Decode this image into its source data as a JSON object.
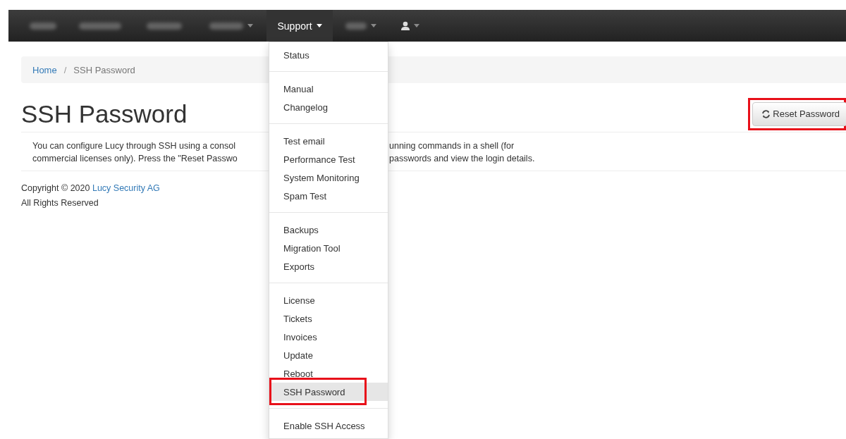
{
  "navbar": {
    "items": [
      {
        "kind": "redacted",
        "selected": false,
        "caret": false
      },
      {
        "kind": "redacted",
        "selected": false,
        "caret": false
      },
      {
        "kind": "redacted",
        "selected": false,
        "caret": false
      },
      {
        "kind": "redacted",
        "selected": false,
        "caret": true
      },
      {
        "kind": "text",
        "label": "Support",
        "selected": true,
        "caret": true
      },
      {
        "kind": "redacted",
        "selected": false,
        "caret": true
      },
      {
        "kind": "user",
        "selected": false,
        "caret": true
      }
    ]
  },
  "breadcrumb": {
    "separator": "/",
    "items": [
      {
        "label": "Home",
        "kind": "link"
      },
      {
        "label": "SSH Password",
        "kind": "current"
      }
    ]
  },
  "heading": "SSH Password",
  "reset_button": {
    "label": "Reset Password",
    "annotated": true
  },
  "paragraph_lines": [
    {
      "left": "You can configure Lucy through SSH using a consol",
      "right": "unning commands in a shell (for"
    },
    {
      "left": "commercial licenses only). Press the \"Reset Passwo",
      "right": "passwords and view the login details."
    }
  ],
  "footer": {
    "copyright": "Copyright © 2020",
    "company": "Lucy Security AG",
    "rights": "All Rights Reserved"
  },
  "support_menu": {
    "groups": [
      [
        {
          "label": "Status",
          "selected": false,
          "annotated": false
        }
      ],
      [
        {
          "label": "Manual",
          "selected": false,
          "annotated": false
        },
        {
          "label": "Changelog",
          "selected": false,
          "annotated": false
        }
      ],
      [
        {
          "label": "Test email",
          "selected": false,
          "annotated": false
        },
        {
          "label": "Performance Test",
          "selected": false,
          "annotated": false
        },
        {
          "label": "System Monitoring",
          "selected": false,
          "annotated": false
        },
        {
          "label": "Spam Test",
          "selected": false,
          "annotated": false
        }
      ],
      [
        {
          "label": "Backups",
          "selected": false,
          "annotated": false
        },
        {
          "label": "Migration Tool",
          "selected": false,
          "annotated": false
        },
        {
          "label": "Exports",
          "selected": false,
          "annotated": false
        }
      ],
      [
        {
          "label": "License",
          "selected": false,
          "annotated": false
        },
        {
          "label": "Tickets",
          "selected": false,
          "annotated": false
        },
        {
          "label": "Invoices",
          "selected": false,
          "annotated": false
        },
        {
          "label": "Update",
          "selected": false,
          "annotated": false
        },
        {
          "label": "Reboot",
          "selected": false,
          "annotated": false
        },
        {
          "label": "SSH Password",
          "selected": true,
          "annotated": true
        }
      ],
      [
        {
          "label": "Enable SSH Access",
          "selected": false,
          "annotated": false
        }
      ]
    ]
  }
}
